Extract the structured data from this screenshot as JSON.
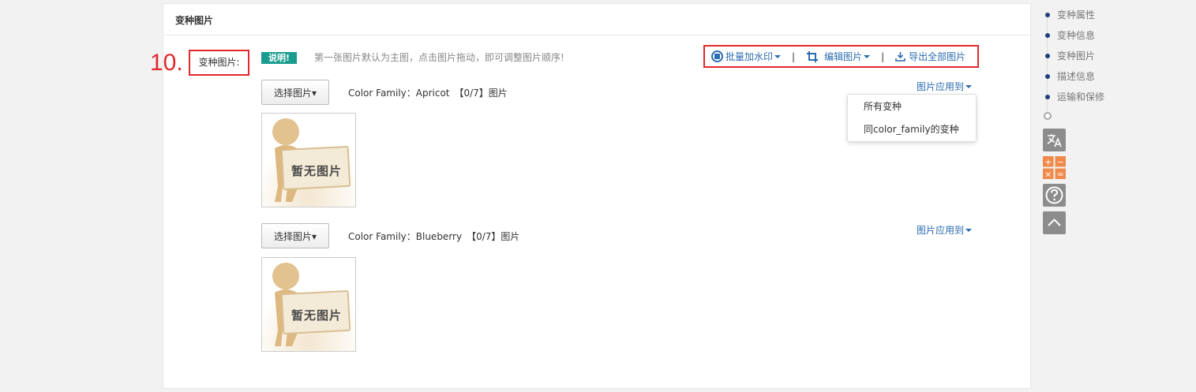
{
  "panel": {
    "title": "变种图片"
  },
  "step_number": "10.",
  "field_label": "变种图片:",
  "tip": {
    "badge": "说明!",
    "text": "第一张图片默认为主图，点击图片拖动，即可调整图片顺序!"
  },
  "toolbar": {
    "watermark": "批量加水印",
    "edit": "编辑图片",
    "separator": "|",
    "export": "导出全部图片"
  },
  "variants": [
    {
      "select_label": "选择图片▾",
      "info": "Color Family：Apricot　【0/7】图片",
      "apply_label": "图片应用到"
    },
    {
      "select_label": "选择图片▾",
      "info": "Color Family：Blueberry　【0/7】图片",
      "apply_label": "图片应用到"
    }
  ],
  "placeholder_text": "暂无图片",
  "dropdown": {
    "items": [
      "所有变种",
      "同color_family的变种"
    ]
  },
  "side_nav": {
    "items": [
      "变种属性",
      "变种信息",
      "变种图片",
      "描述信息",
      "运输和保修"
    ]
  },
  "tools": {
    "calc_symbols": [
      "+",
      "−",
      "×",
      "="
    ]
  },
  "colors": {
    "accent": "#e0282e",
    "link": "#2b6cb0",
    "badge": "#1a9c8e",
    "nav_dot": "#1f3f7a",
    "calc": "#f08a4b"
  }
}
